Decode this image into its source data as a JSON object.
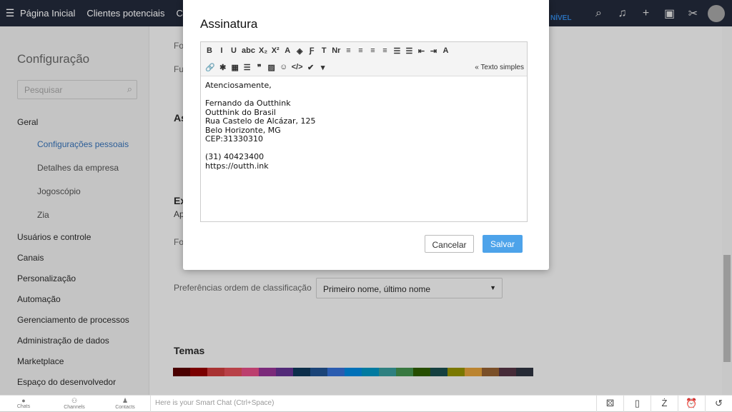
{
  "topbar": {
    "nav": [
      "Página Inicial",
      "Clientes potenciais",
      "Co"
    ],
    "upgrade": "NÍVEL"
  },
  "sidebar": {
    "title": "Configuração",
    "search_placeholder": "Pesquisar",
    "sections": [
      {
        "label": "Geral",
        "items": [
          "Configurações pessoais",
          "Detalhes da empresa",
          "Jogoscópio",
          "Zia"
        ]
      }
    ],
    "items": [
      "Usuários e controle",
      "Canais",
      "Personalização",
      "Automação",
      "Gerenciamento de processos",
      "Administração de dados",
      "Marketplace",
      "Espaço do desenvolvedor"
    ]
  },
  "main": {
    "partial": [
      "Fo",
      "Fu",
      "As",
      "Ex",
      "Ap",
      "Fo"
    ],
    "sort_label": "Preferências ordem de classificação",
    "sort_value": "Primeiro nome, último nome",
    "themes_title": "Temas",
    "theme_colors": [
      "#4a0000",
      "#7a0000",
      "#a83232",
      "#b84148",
      "#bc3f6e",
      "#7b2a7a",
      "#522a78",
      "#0c2e4a",
      "#1b4478",
      "#2b5cb0",
      "#0070b8",
      "#007aa0",
      "#2e8080",
      "#387840",
      "#264d00",
      "#154040",
      "#7a7800",
      "#bb8430",
      "#7a4f28",
      "#462b38",
      "#262a35"
    ]
  },
  "dialog": {
    "title": "Assinatura",
    "plain_text": "« Texto simples",
    "toolbar_row1": [
      "B",
      "I",
      "U",
      "abc",
      "X₂",
      "X²",
      "A",
      "◈",
      "Ƒ",
      "T",
      "Nr",
      "≡",
      "≡",
      "≡",
      "≡",
      "☰",
      "☰",
      "⇤",
      "⇥",
      "A"
    ],
    "toolbar_row2": [
      "🔗",
      "✱",
      "▦",
      "☰",
      "❞",
      "▨",
      "☺",
      "</>",
      "✔",
      "▾"
    ],
    "content": "Atenciosamente,\n\nFernando da Outthink\nOutthink do Brasil\nRua Castelo de Alcázar, 125\nBelo Horizonte, MG\nCEP:31330310\n\n(31) 40423400\nhttps://outth.ink",
    "cancel": "Cancelar",
    "save": "Salvar"
  },
  "bottombar": {
    "chats": "Chats",
    "channels": "Channels",
    "contacts": "Contacts",
    "smart_chat_placeholder": "Here is your Smart Chat (Ctrl+Space)"
  }
}
